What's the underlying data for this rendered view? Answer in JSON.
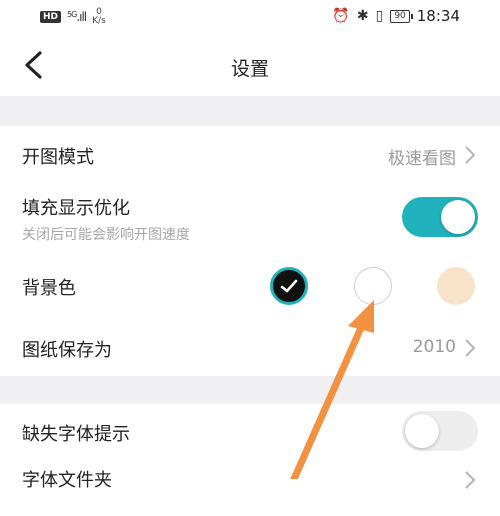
{
  "status_bar": {
    "hd": "HD",
    "network": "5G",
    "signal": ".ıll",
    "speed_value": "0",
    "speed_unit": "K/s",
    "battery": "90",
    "time": "18:34"
  },
  "header": {
    "title": "设置"
  },
  "settings": {
    "open_mode": {
      "label": "开图模式",
      "value": "极速看图"
    },
    "fill_optimize": {
      "label": "填充显示优化",
      "sublabel": "关闭后可能会影响开图速度",
      "enabled": true
    },
    "background": {
      "label": "背景色",
      "swatches": [
        "#111111",
        "#ffffff",
        "#f9e3cb"
      ],
      "selected_index": 0
    },
    "save_as": {
      "label": "图纸保存为",
      "value": "2010"
    },
    "missing_font": {
      "label": "缺失字体提示",
      "enabled": false
    },
    "font_file": {
      "label": "字体文件夹"
    }
  },
  "colors": {
    "accent": "#20b2bc",
    "annotation_arrow": "#f2913f",
    "divider_bg": "#f0f0f2"
  },
  "icons": [
    "back-arrow-icon",
    "chevron-right-icon",
    "checkmark-icon",
    "alarm-icon",
    "bluetooth-icon",
    "vibrate-icon",
    "battery-icon"
  ]
}
